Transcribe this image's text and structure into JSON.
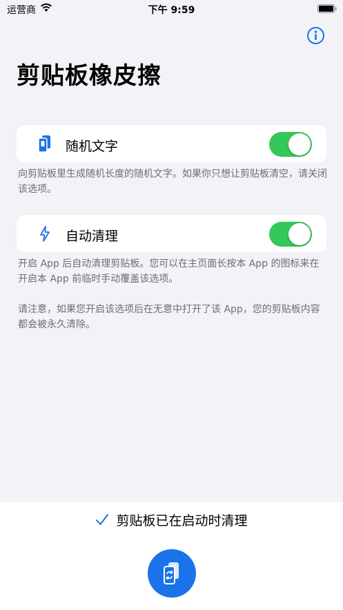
{
  "status_bar": {
    "carrier": "运营商",
    "time": "下午 9:59"
  },
  "title": "剪贴板橡皮擦",
  "settings": [
    {
      "label": "随机文字",
      "enabled": true,
      "icon": "phone-copy-icon",
      "description": "向剪贴板里生成随机长度的随机文字。如果你只想让剪贴板清空，请关闭该选项。"
    },
    {
      "label": "自动清理",
      "enabled": true,
      "icon": "bolt-icon",
      "description": "开启 App 后自动清理剪贴板。您可以在主页面长按本 App 的图标来在开启本 App 前临时手动覆盖该选项。",
      "note": "请注意，如果您开启该选项后在无意中打开了该 App，您的剪贴板内容都会被永久清除。"
    }
  ],
  "bottom": {
    "status": "剪贴板已在启动时清理",
    "fab_icon": "clipboard-refresh-icon"
  },
  "colors": {
    "accent": "#1a73e8",
    "toggle_on": "#34c759"
  }
}
